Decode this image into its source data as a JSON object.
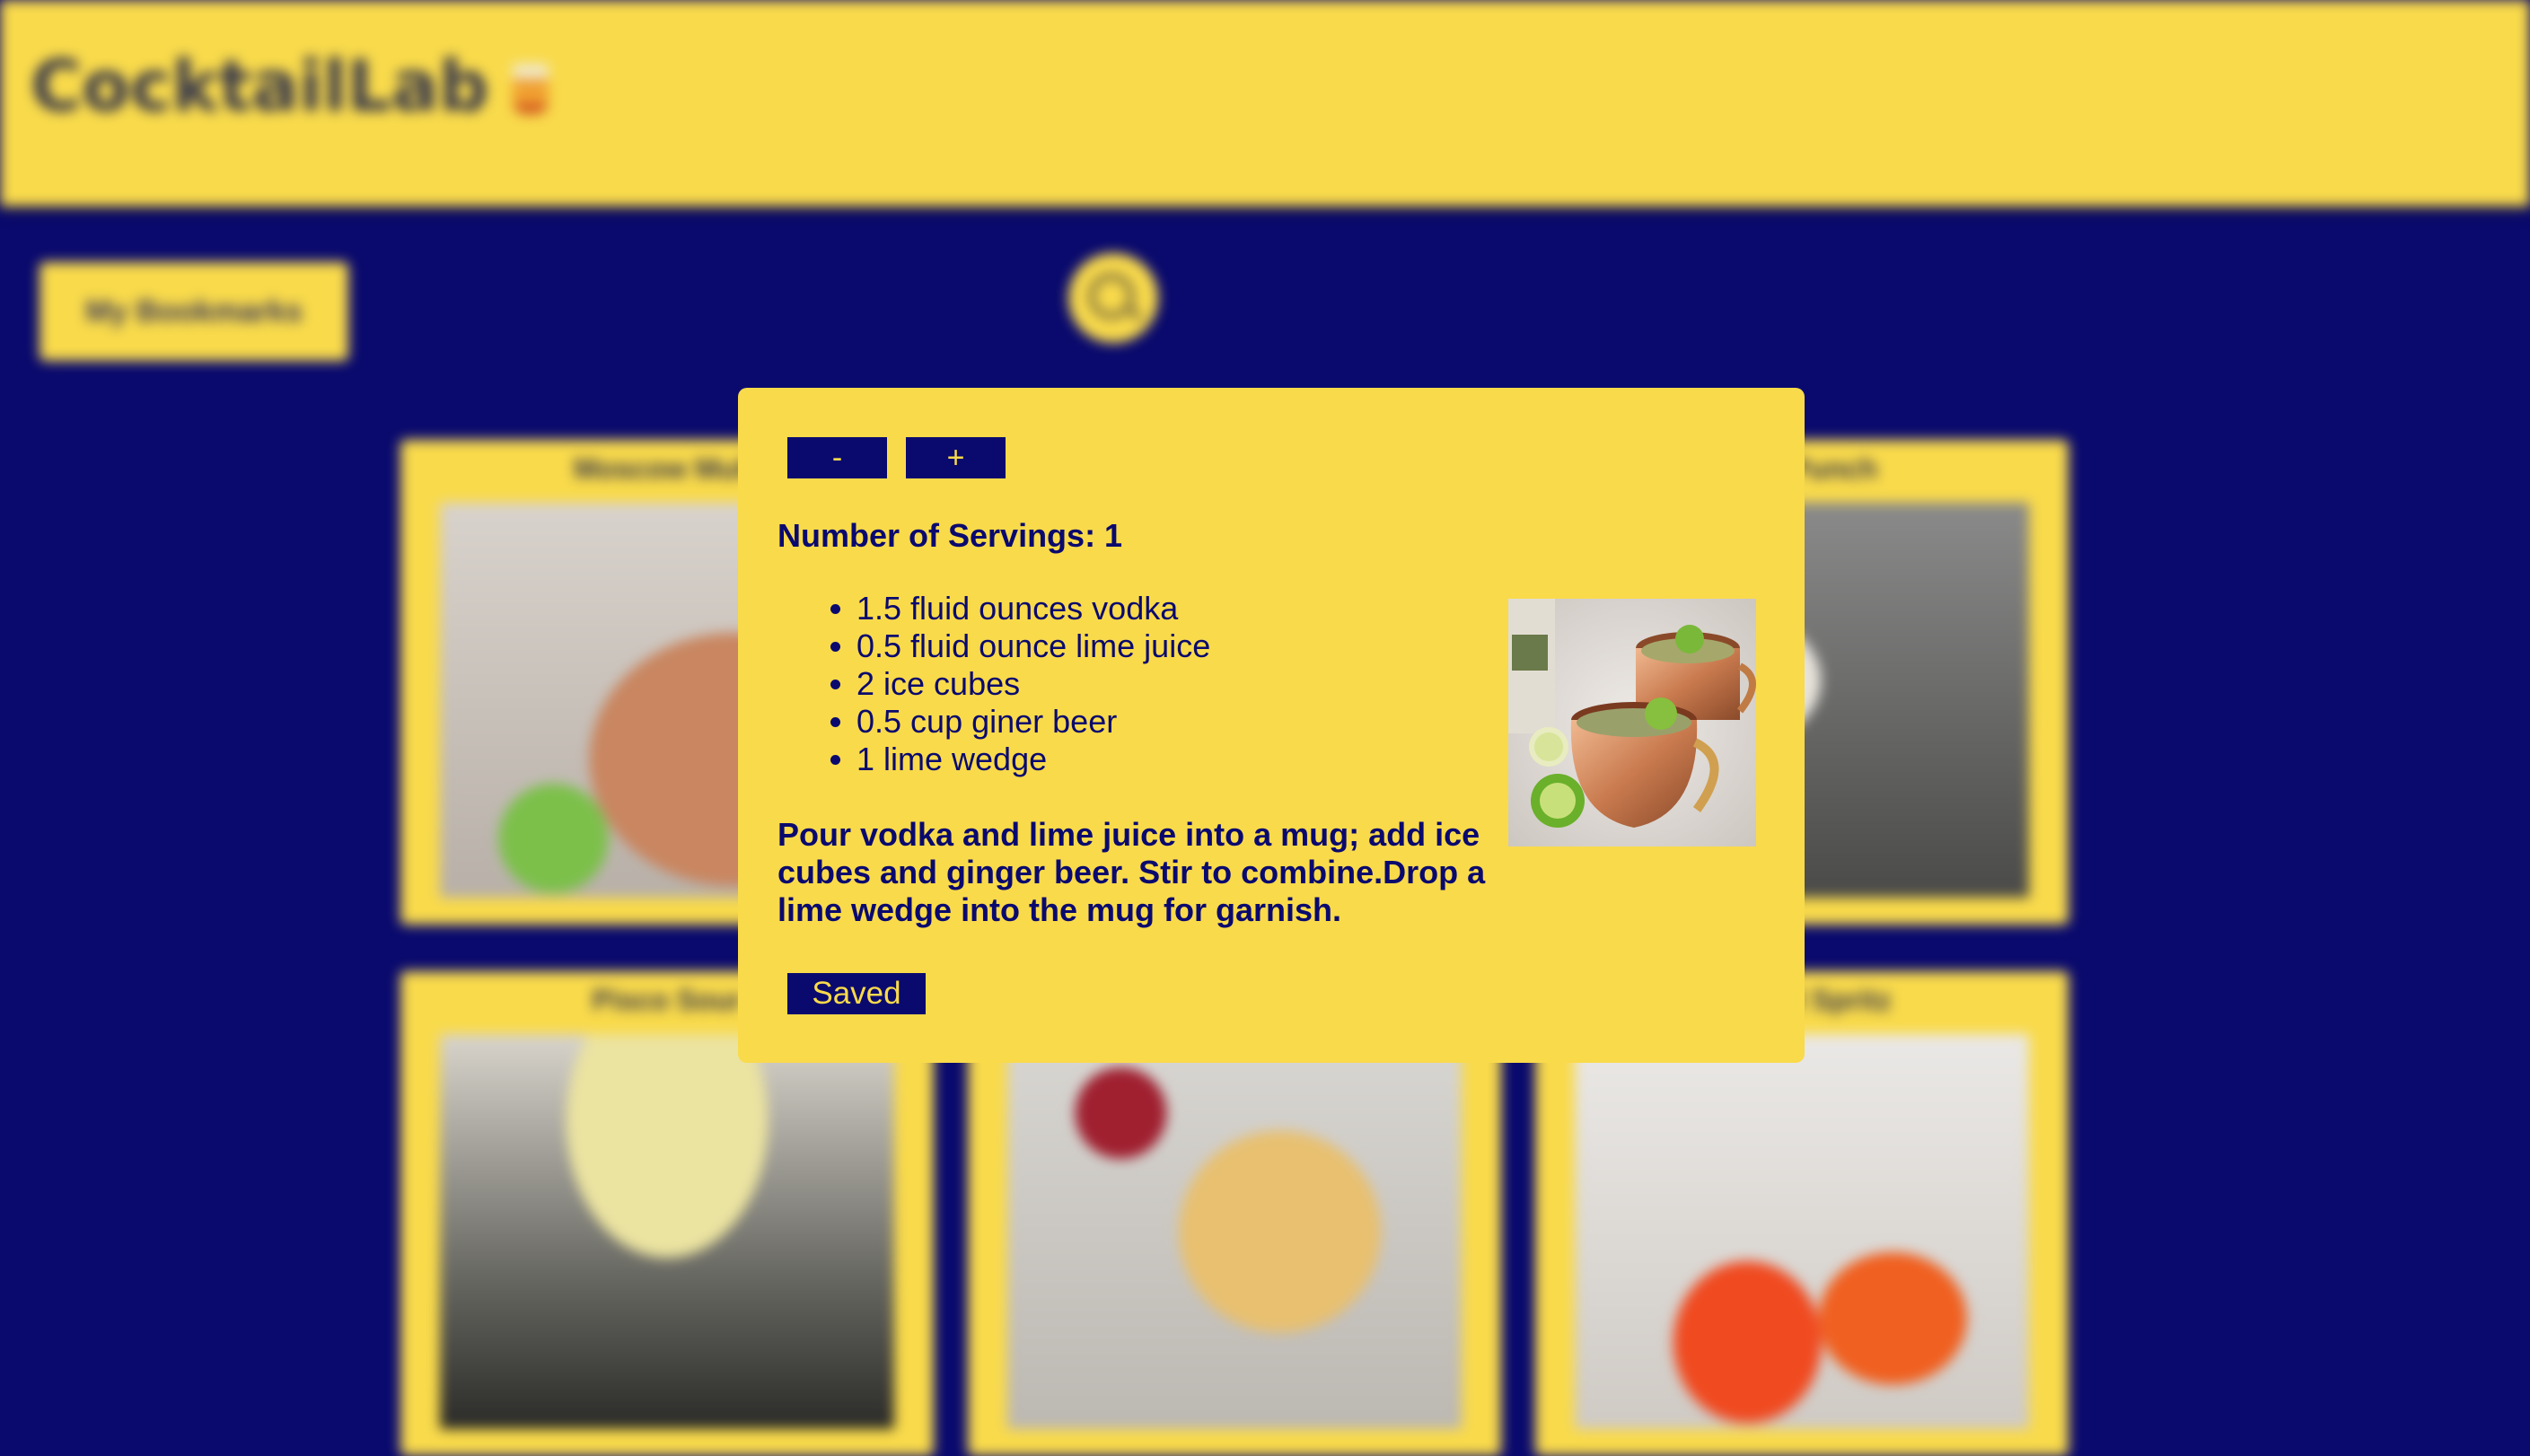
{
  "header": {
    "title": "CocktailLab"
  },
  "toolbar": {
    "bookmarks_label": "My Bookmarks"
  },
  "cards": [
    {
      "title": "Moscow Mule"
    },
    {
      "title": "Milk Punch"
    },
    {
      "title": "Pisco Sour"
    },
    {
      "title": ""
    },
    {
      "title": "Aperol Spritz"
    }
  ],
  "modal": {
    "minus_label": "-",
    "plus_label": "+",
    "servings_text": "Number of Servings: 1",
    "ingredients": [
      "1.5 fluid ounces vodka",
      "0.5 fluid ounce lime juice",
      "2 ice cubes",
      "0.5 cup giner beer",
      "1 lime wedge"
    ],
    "instructions": "Pour vodka and lime juice into a mug; add ice cubes and ginger beer. Stir to combine.Drop a lime wedge into the mug for garnish.",
    "saved_label": "Saved"
  },
  "colors": {
    "accent": "#f9da4b",
    "background": "#0a0a6e"
  }
}
